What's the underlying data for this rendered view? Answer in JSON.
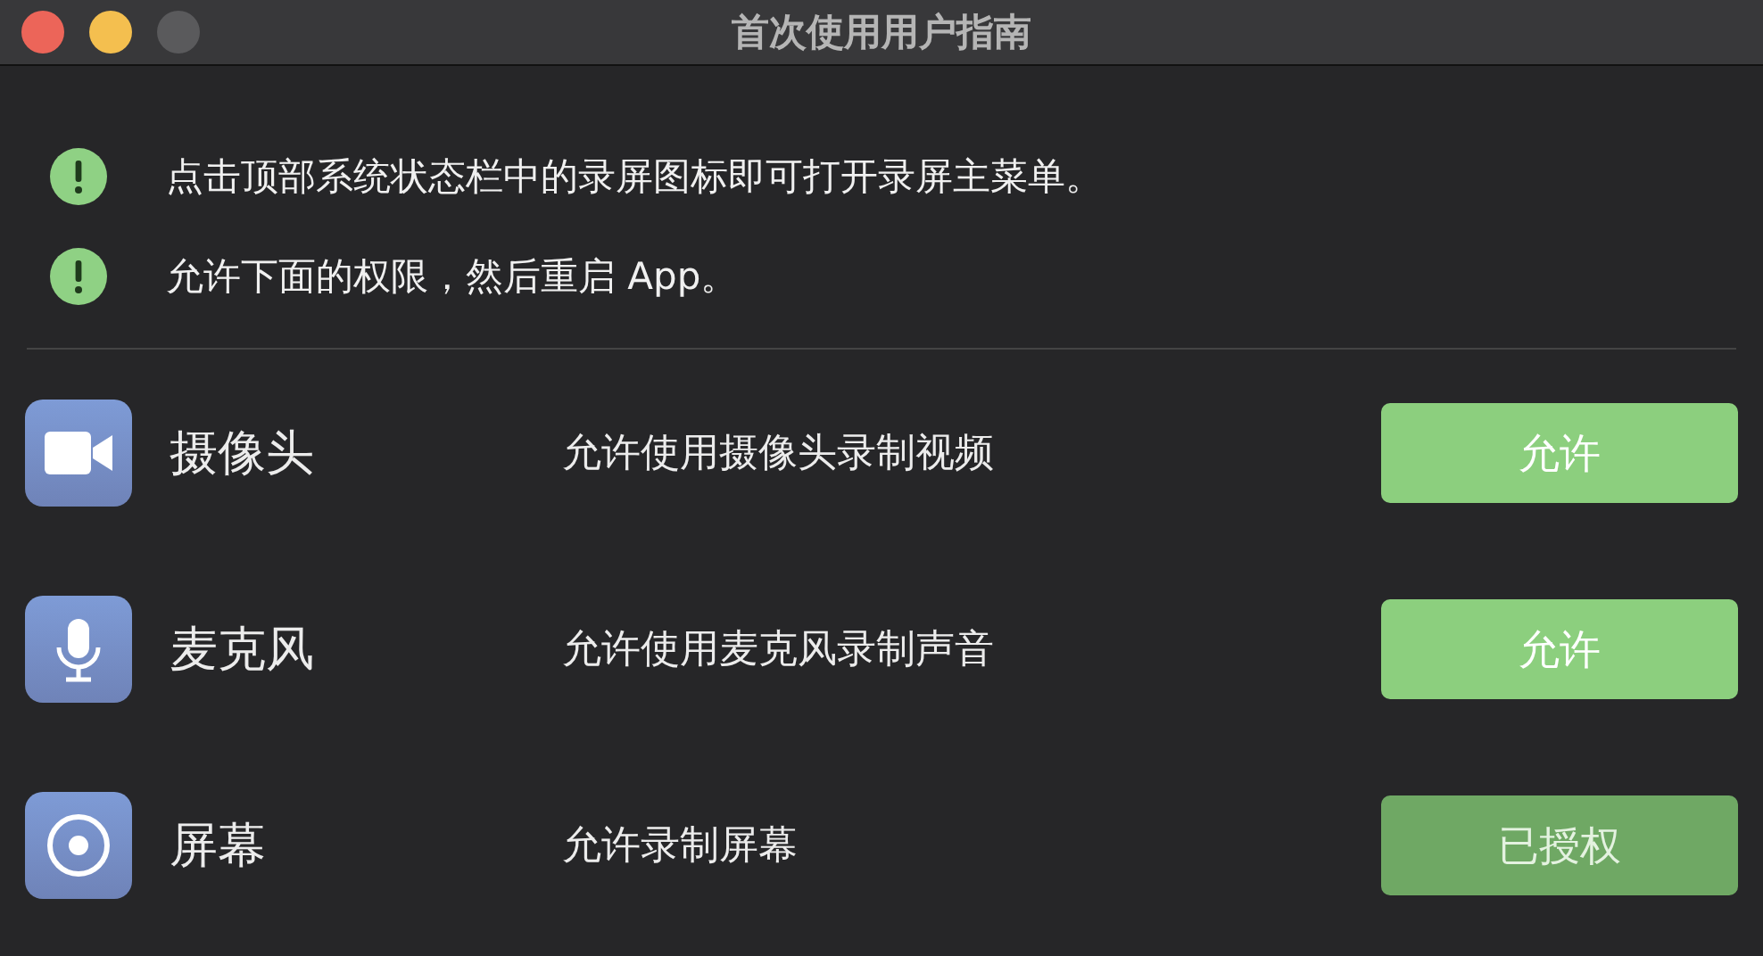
{
  "window": {
    "title": "首次使用用户指南"
  },
  "notes": [
    "点击顶部系统状态栏中的录屏图标即可打开录屏主菜单。",
    "允许下面的权限，然后重启 App。"
  ],
  "permissions": [
    {
      "kind": "camera",
      "name": "摄像头",
      "description": "允许使用摄像头录制视频",
      "button": "允许",
      "disabled": false
    },
    {
      "kind": "microphone",
      "name": "麦克风",
      "description": "允许使用麦克风录制声音",
      "button": "允许",
      "disabled": false
    },
    {
      "kind": "screen",
      "name": "屏幕",
      "description": "允许录制屏幕",
      "button": "已授权",
      "disabled": true
    }
  ]
}
